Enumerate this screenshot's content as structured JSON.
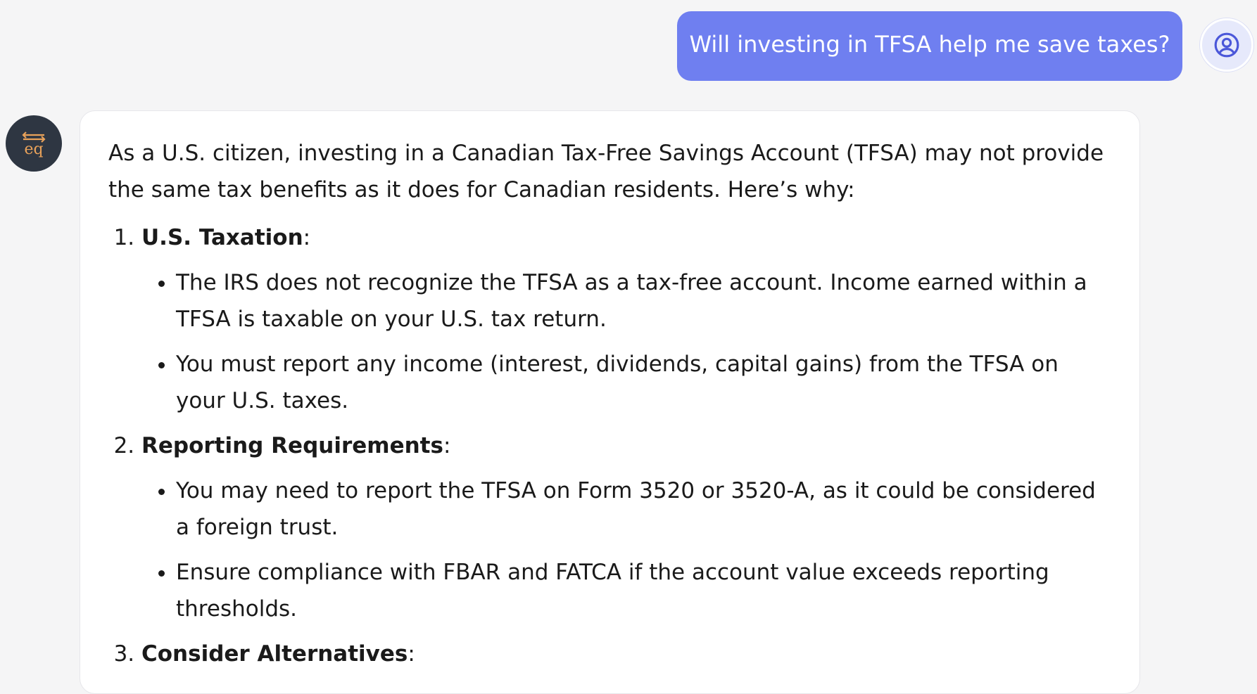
{
  "user_message": {
    "text": "Will investing in TFSA help me save taxes?"
  },
  "assistant": {
    "logo_text": "eq",
    "intro": "As a U.S. citizen, investing in a Canadian Tax-Free Savings Account (TFSA) may not provide the same tax benefits as it does for Canadian residents. Here’s why:",
    "points": [
      {
        "title": "U.S. Taxation",
        "suffix": ":",
        "bullets": [
          "The IRS does not recognize the TFSA as a tax-free account. Income earned within a TFSA is taxable on your U.S. tax return.",
          "You must report any income (interest, dividends, capital gains) from the TFSA on your U.S. taxes."
        ]
      },
      {
        "title": "Reporting Requirements",
        "suffix": ":",
        "bullets": [
          "You may need to report the TFSA on Form 3520 or 3520-A, as it could be considered a foreign trust.",
          "Ensure compliance with FBAR and FATCA if the account value exceeds reporting thresholds."
        ]
      },
      {
        "title": "Consider Alternatives",
        "suffix": ":",
        "bullets": []
      }
    ]
  },
  "colors": {
    "page_background": "#f5f5f6",
    "user_bubble": "#6f7ff0",
    "user_avatar_icon": "#4b57d9",
    "bot_avatar_background": "#2e3642",
    "bot_logo": "#e9a25a"
  },
  "icons": {
    "user_avatar": "user-circle-icon",
    "bot_avatar": "eq-logo"
  }
}
